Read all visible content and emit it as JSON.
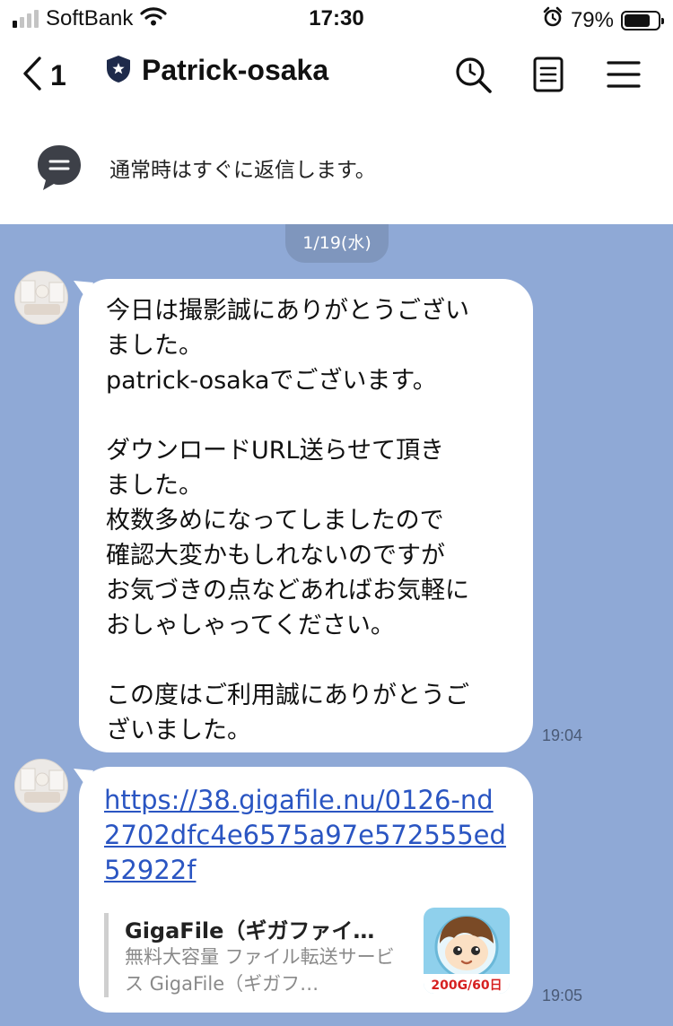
{
  "status_bar": {
    "carrier": "SoftBank",
    "time": "17:30",
    "battery_percent": "79%",
    "battery_level": 0.79,
    "signal_bars_on": 1,
    "icons": [
      "signal-icon",
      "wifi-icon",
      "alarm-icon",
      "battery-icon"
    ]
  },
  "header": {
    "back_count": "1",
    "title": "Patrick-osaka",
    "icons": [
      "back-chevron-icon",
      "shield-badge-icon",
      "search-icon",
      "notes-icon",
      "menu-icon"
    ]
  },
  "notice": {
    "text": "通常時はすぐに返信します。",
    "icon": "speech-bubble-icon"
  },
  "chat": {
    "date": "1/19(水)",
    "messages": [
      {
        "text": "今日は撮影誠にありがとうござい\nました。\npatrick-osakaでございます。\n\nダウンロードURL送らせて頂き\nました。\n枚数多めになってしましたので\n確認大変かもしれないのですが\nお気づきの点などあればお気軽に\nおしゃしゃってください。\n\nこの度はご利用誠にありがとうご\nざいました。",
        "time": "19:04"
      },
      {
        "link": "https://38.gigafile.nu/0126-nd2702dfc4e6575a97e572555ed52922f",
        "preview_title": "GigaFile（ギガファイ…",
        "preview_desc": "無料大容量 ファイル転送サービス GigaFile（ギガフ…",
        "preview_badge": "200G/60日",
        "time": "19:05"
      }
    ]
  },
  "colors": {
    "chat_background": "#8fa9d6",
    "link": "#2a55c2",
    "date_pill": "#7f96bd"
  }
}
